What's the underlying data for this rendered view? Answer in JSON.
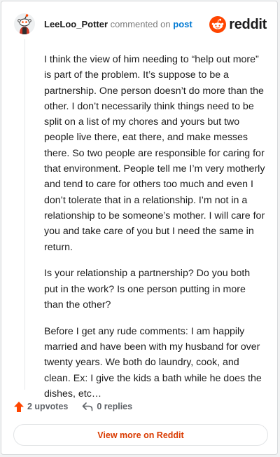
{
  "header": {
    "username": "LeeLoo_Potter",
    "commented_on": "commented on",
    "post_link": "post",
    "brand_word": "reddit",
    "brand_color": "#ff4500"
  },
  "comment": {
    "paragraphs": [
      "I think the view of him needing to “help out more” is part of the problem. It’s suppose to be a partnership. One person doesn’t do more than the other. I don’t necessarily think things need to be split on a list of my chores and yours but two people live there, eat there, and make messes there. So two people are responsible for caring for that environment. People tell me I’m very motherly and tend to care for others too much and even I don’t tolerate that in a relationship. I’m not in a relationship to be someone’s mother. I will care for you and take care of you but I need the same in return.",
      "Is your relationship a partnership? Do you both put in the work? Is one person putting in more than the other?",
      "Before I get any rude comments: I am happily married and have been with my husband for over twenty years. We both do laundry, cook, and clean. Ex: I give the kids a bath while he does the dishes, etc…"
    ]
  },
  "actions": {
    "upvotes": "2 upvotes",
    "replies": "0 replies",
    "upvote_icon": "upvote-arrow-icon",
    "reply_icon": "reply-arrow-icon"
  },
  "footer": {
    "view_more": "View more on Reddit"
  }
}
